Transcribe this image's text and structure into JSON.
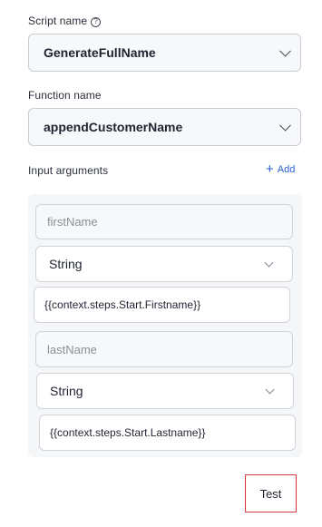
{
  "script": {
    "label": "Script name",
    "help_icon": "question-circle-icon",
    "value": "GenerateFullName"
  },
  "function": {
    "label": "Function name",
    "value": "appendCustomerName"
  },
  "input_arguments": {
    "label": "Input arguments",
    "add_label": "Add",
    "add_icon": "plus-icon",
    "args": [
      {
        "name_placeholder": "firstName",
        "type": "String",
        "value": "{{context.steps.Start.Firstname}}"
      },
      {
        "name_placeholder": "lastName",
        "type": "String",
        "value": "{{context.steps.Start.Lastname}}"
      }
    ]
  },
  "actions": {
    "test_label": "Test"
  },
  "colors": {
    "accent": "#2b5fd9",
    "highlight_border": "#d9363e"
  }
}
